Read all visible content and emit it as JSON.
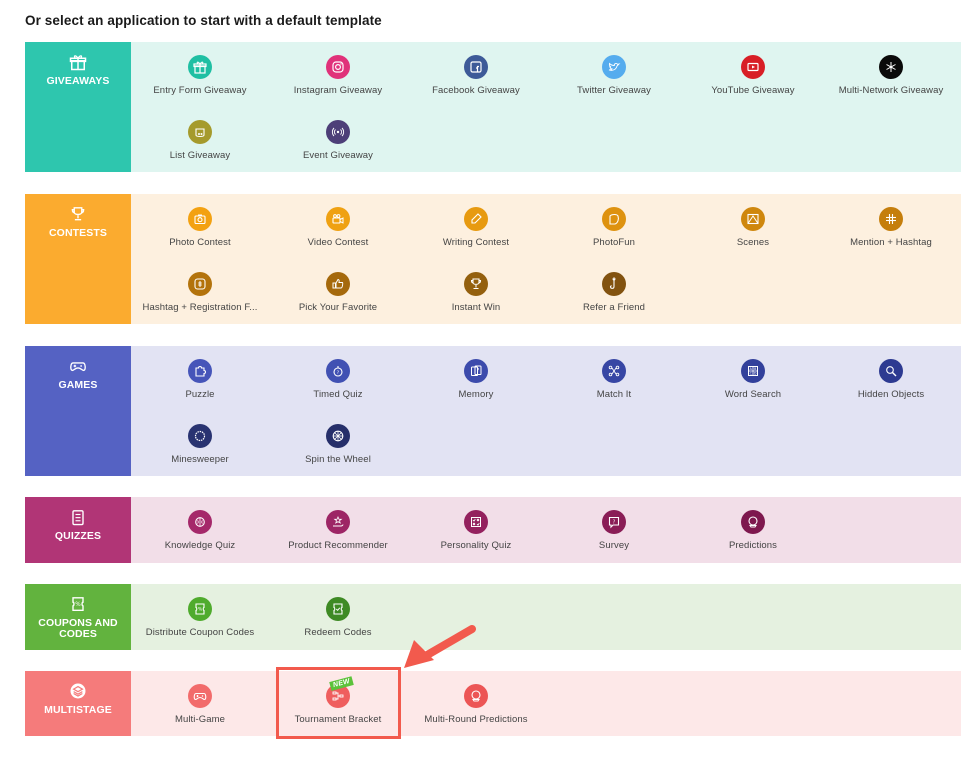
{
  "heading": "Or select an application to start with a default template",
  "sections": [
    {
      "id": "giveaways",
      "label": "GIVEAWAYS",
      "icon": "gift-icon",
      "color": "#2ec6ae",
      "bg": "#dff5f0",
      "apps": [
        {
          "label": "Entry Form Giveaway",
          "icon": "gift-icon",
          "color": "#1fbfa3"
        },
        {
          "label": "Instagram Giveaway",
          "icon": "instagram-icon",
          "color": "#e0327a"
        },
        {
          "label": "Facebook Giveaway",
          "icon": "facebook-icon",
          "color": "#3d5a98"
        },
        {
          "label": "Twitter Giveaway",
          "icon": "twitter-icon",
          "color": "#55acee"
        },
        {
          "label": "YouTube Giveaway",
          "icon": "youtube-icon",
          "color": "#d81e26"
        },
        {
          "label": "Multi-Network Giveaway",
          "icon": "network-icon",
          "color": "#0a0a0a"
        },
        {
          "label": "List Giveaway",
          "icon": "jar-icon",
          "color": "#a59a2c"
        },
        {
          "label": "Event Giveaway",
          "icon": "broadcast-icon",
          "color": "#4d3f78"
        }
      ]
    },
    {
      "id": "contests",
      "label": "CONTESTS",
      "icon": "trophy-icon",
      "color": "#fbab2f",
      "bg": "#fdf0df",
      "apps": [
        {
          "label": "Photo Contest",
          "icon": "camera-icon",
          "color": "#f3a111"
        },
        {
          "label": "Video Contest",
          "icon": "video-camera-icon",
          "color": "#efa112"
        },
        {
          "label": "Writing Contest",
          "icon": "pen-icon",
          "color": "#e79a10"
        },
        {
          "label": "PhotoFun",
          "icon": "photofun-icon",
          "color": "#de920f"
        },
        {
          "label": "Scenes",
          "icon": "scenes-icon",
          "color": "#cf870d"
        },
        {
          "label": "Mention + Hashtag",
          "icon": "hashtag-icon",
          "color": "#c57e0c"
        },
        {
          "label": "Hashtag + Registration F...",
          "icon": "registration-icon",
          "color": "#b3730c"
        },
        {
          "label": "Pick Your Favorite",
          "icon": "thumbs-up-icon",
          "color": "#a5690c"
        },
        {
          "label": "Instant Win",
          "icon": "trophy-icon",
          "color": "#94600e"
        },
        {
          "label": "Refer a Friend",
          "icon": "hook-icon",
          "color": "#82520f"
        }
      ]
    },
    {
      "id": "games",
      "label": "GAMES",
      "icon": "gamepad-icon",
      "color": "#5562c3",
      "bg": "#e2e3f3",
      "apps": [
        {
          "label": "Puzzle",
          "icon": "puzzle-icon",
          "color": "#4655b9"
        },
        {
          "label": "Timed Quiz",
          "icon": "stopwatch-icon",
          "color": "#4151b3"
        },
        {
          "label": "Memory",
          "icon": "cards-icon",
          "color": "#3c4bac"
        },
        {
          "label": "Match It",
          "icon": "match-icon",
          "color": "#3746a4"
        },
        {
          "label": "Word Search",
          "icon": "word-grid-icon",
          "color": "#32409b"
        },
        {
          "label": "Hidden Objects",
          "icon": "magnifier-icon",
          "color": "#2d3a91"
        },
        {
          "label": "Minesweeper",
          "icon": "mine-icon",
          "color": "#293371"
        },
        {
          "label": "Spin the Wheel",
          "icon": "wheel-icon",
          "color": "#262f6a"
        }
      ]
    },
    {
      "id": "quizzes",
      "label": "QUIZZES",
      "icon": "checklist-icon",
      "color": "#b13576",
      "bg": "#f2dee8",
      "apps": [
        {
          "label": "Knowledge Quiz",
          "icon": "brain-icon",
          "color": "#a5286a"
        },
        {
          "label": "Product Recommender",
          "icon": "hand-star-icon",
          "color": "#9d2565"
        },
        {
          "label": "Personality Quiz",
          "icon": "check-cross-grid-icon",
          "color": "#94215e"
        },
        {
          "label": "Survey",
          "icon": "question-bubble-icon",
          "color": "#8a1d56"
        },
        {
          "label": "Predictions",
          "icon": "crystal-ball-icon",
          "color": "#7e184e"
        }
      ]
    },
    {
      "id": "coupons",
      "label": "COUPONS AND CODES",
      "icon": "coupon-icon",
      "color": "#62b33e",
      "bg": "#e5f1e0",
      "apps": [
        {
          "label": "Distribute Coupon Codes",
          "icon": "coupon-icon",
          "color": "#4fab2d"
        },
        {
          "label": "Redeem Codes",
          "icon": "coupon-check-icon",
          "color": "#3e8a24"
        }
      ]
    },
    {
      "id": "multistage",
      "label": "MULTISTAGE",
      "icon": "layers-icon",
      "color": "#f57b7b",
      "bg": "#fde8e8",
      "apps": [
        {
          "label": "Multi-Game",
          "icon": "gamepad-icon",
          "color": "#f26b6b"
        },
        {
          "label": "Tournament Bracket",
          "icon": "bracket-icon",
          "color": "#ef5e5e",
          "badge": "NEW"
        },
        {
          "label": "Multi-Round Predictions",
          "icon": "crystal-ball-icon",
          "color": "#ec5555"
        }
      ]
    }
  ],
  "highlight": {
    "target": "Tournament Bracket",
    "color": "#f25a4d"
  }
}
